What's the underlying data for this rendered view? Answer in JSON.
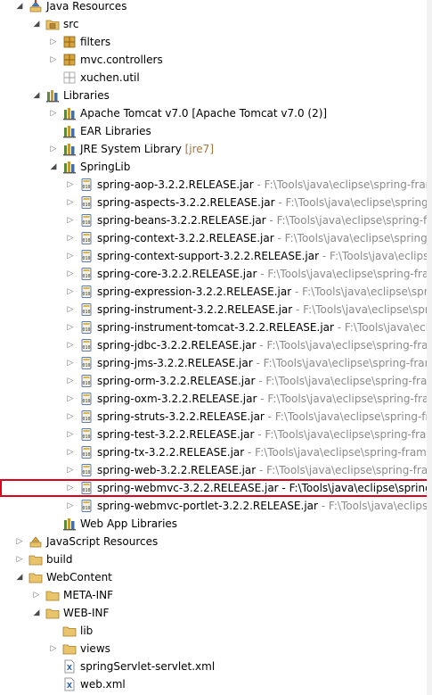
{
  "colors": {
    "highlight": "#e0001a",
    "decoration": "#8b8b8b",
    "version": "#a6763a",
    "folder": "#e9c46a",
    "jar": "#5a7fb0"
  },
  "tree": [
    {
      "label": "Java Resources",
      "decoration": "",
      "level": 0,
      "toggle": "open",
      "icon": "java-resources",
      "name": "tree-item-java-resources"
    },
    {
      "label": "src",
      "decoration": "",
      "level": 1,
      "toggle": "open",
      "icon": "source-folder",
      "name": "tree-item-src"
    },
    {
      "label": "filters",
      "decoration": "",
      "level": 2,
      "toggle": "closed",
      "icon": "package",
      "name": "tree-item-filters"
    },
    {
      "label": "mvc.controllers",
      "decoration": "",
      "level": 2,
      "toggle": "closed",
      "icon": "package",
      "name": "tree-item-mvc-controllers"
    },
    {
      "label": "xuchen.util",
      "decoration": "",
      "level": 2,
      "toggle": "none",
      "icon": "empty-package",
      "name": "tree-item-xuchen-util"
    },
    {
      "label": "Libraries",
      "decoration": "",
      "level": 1,
      "toggle": "open",
      "icon": "library",
      "name": "tree-item-libraries"
    },
    {
      "label": "Apache Tomcat v7.0 [Apache Tomcat v7.0 (2)]",
      "decoration": "",
      "level": 2,
      "toggle": "closed",
      "icon": "library",
      "name": "tree-item-apache-tomcat"
    },
    {
      "label": "EAR Libraries",
      "decoration": "",
      "level": 2,
      "toggle": "none",
      "icon": "library",
      "name": "tree-item-ear-libraries"
    },
    {
      "label": "JRE System Library",
      "decoration": " [jre7]",
      "decoration_style": "ver",
      "level": 2,
      "toggle": "closed",
      "icon": "library",
      "name": "tree-item-jre-system-library"
    },
    {
      "label": "SpringLib",
      "decoration": "",
      "level": 2,
      "toggle": "open",
      "icon": "library",
      "name": "tree-item-springlib"
    },
    {
      "label": "spring-aop-3.2.2.RELEASE.jar",
      "decoration": " - F:\\Tools\\java\\eclipse\\spring-fram",
      "level": 3,
      "toggle": "closed",
      "icon": "jar",
      "name": "tree-item-jar"
    },
    {
      "label": "spring-aspects-3.2.2.RELEASE.jar",
      "decoration": " - F:\\Tools\\java\\eclipse\\spring-f",
      "level": 3,
      "toggle": "closed",
      "icon": "jar",
      "name": "tree-item-jar"
    },
    {
      "label": "spring-beans-3.2.2.RELEASE.jar",
      "decoration": " - F:\\Tools\\java\\eclipse\\spring-fra",
      "level": 3,
      "toggle": "closed",
      "icon": "jar",
      "name": "tree-item-jar"
    },
    {
      "label": "spring-context-3.2.2.RELEASE.jar",
      "decoration": " - F:\\Tools\\java\\eclipse\\spring-f",
      "level": 3,
      "toggle": "closed",
      "icon": "jar",
      "name": "tree-item-jar"
    },
    {
      "label": "spring-context-support-3.2.2.RELEASE.jar",
      "decoration": " - F:\\Tools\\java\\eclipse\\",
      "level": 3,
      "toggle": "closed",
      "icon": "jar",
      "name": "tree-item-jar"
    },
    {
      "label": "spring-core-3.2.2.RELEASE.jar",
      "decoration": " - F:\\Tools\\java\\eclipse\\spring-fram",
      "level": 3,
      "toggle": "closed",
      "icon": "jar",
      "name": "tree-item-jar"
    },
    {
      "label": "spring-expression-3.2.2.RELEASE.jar",
      "decoration": " - F:\\Tools\\java\\eclipse\\sprin",
      "level": 3,
      "toggle": "closed",
      "icon": "jar",
      "name": "tree-item-jar"
    },
    {
      "label": "spring-instrument-3.2.2.RELEASE.jar",
      "decoration": " - F:\\Tools\\java\\eclipse\\sprin",
      "level": 3,
      "toggle": "closed",
      "icon": "jar",
      "name": "tree-item-jar"
    },
    {
      "label": "spring-instrument-tomcat-3.2.2.RELEASE.jar",
      "decoration": " - F:\\Tools\\java\\eclip",
      "level": 3,
      "toggle": "closed",
      "icon": "jar",
      "name": "tree-item-jar"
    },
    {
      "label": "spring-jdbc-3.2.2.RELEASE.jar",
      "decoration": " - F:\\Tools\\java\\eclipse\\spring-fram",
      "level": 3,
      "toggle": "closed",
      "icon": "jar",
      "name": "tree-item-jar"
    },
    {
      "label": "spring-jms-3.2.2.RELEASE.jar",
      "decoration": " - F:\\Tools\\java\\eclipse\\spring-fram",
      "level": 3,
      "toggle": "closed",
      "icon": "jar",
      "name": "tree-item-jar"
    },
    {
      "label": "spring-orm-3.2.2.RELEASE.jar",
      "decoration": " - F:\\Tools\\java\\eclipse\\spring-fram",
      "level": 3,
      "toggle": "closed",
      "icon": "jar",
      "name": "tree-item-jar"
    },
    {
      "label": "spring-oxm-3.2.2.RELEASE.jar",
      "decoration": " - F:\\Tools\\java\\eclipse\\spring-fram",
      "level": 3,
      "toggle": "closed",
      "icon": "jar",
      "name": "tree-item-jar"
    },
    {
      "label": "spring-struts-3.2.2.RELEASE.jar",
      "decoration": " - F:\\Tools\\java\\eclipse\\spring-fra",
      "level": 3,
      "toggle": "closed",
      "icon": "jar",
      "name": "tree-item-jar"
    },
    {
      "label": "spring-test-3.2.2.RELEASE.jar",
      "decoration": " - F:\\Tools\\java\\eclipse\\spring-fram",
      "level": 3,
      "toggle": "closed",
      "icon": "jar",
      "name": "tree-item-jar"
    },
    {
      "label": "spring-tx-3.2.2.RELEASE.jar",
      "decoration": " - F:\\Tools\\java\\eclipse\\spring-framev",
      "level": 3,
      "toggle": "closed",
      "icon": "jar",
      "name": "tree-item-jar"
    },
    {
      "label": "spring-web-3.2.2.RELEASE.jar",
      "decoration": " - F:\\Tools\\java\\eclipse\\spring-fram",
      "level": 3,
      "toggle": "closed",
      "icon": "jar",
      "name": "tree-item-jar"
    },
    {
      "label": "spring-webmvc-3.2.2.RELEASE.jar",
      "decoration": " - F:\\Tools\\java\\eclipse\\spring",
      "decoration_style": "dark",
      "level": 3,
      "toggle": "closed",
      "icon": "jar",
      "highlight": true,
      "name": "tree-item-spring-webmvc-jar"
    },
    {
      "label": "spring-webmvc-portlet-3.2.2.RELEASE.jar",
      "decoration": " - F:\\Tools\\java\\eclipse\\",
      "level": 3,
      "toggle": "closed",
      "icon": "jar",
      "name": "tree-item-jar"
    },
    {
      "label": "Web App Libraries",
      "decoration": "",
      "level": 2,
      "toggle": "none",
      "icon": "library",
      "name": "tree-item-web-app-libraries"
    },
    {
      "label": "JavaScript Resources",
      "decoration": "",
      "level": 0,
      "toggle": "closed",
      "icon": "js-resources",
      "name": "tree-item-javascript-resources"
    },
    {
      "label": "build",
      "decoration": "",
      "level": 0,
      "toggle": "closed",
      "icon": "folder",
      "name": "tree-item-build"
    },
    {
      "label": "WebContent",
      "decoration": "",
      "level": 0,
      "toggle": "open",
      "icon": "folder",
      "name": "tree-item-webcontent"
    },
    {
      "label": "META-INF",
      "decoration": "",
      "level": 1,
      "toggle": "closed",
      "icon": "folder",
      "name": "tree-item-meta-inf"
    },
    {
      "label": "WEB-INF",
      "decoration": "",
      "level": 1,
      "toggle": "open",
      "icon": "folder",
      "name": "tree-item-web-inf"
    },
    {
      "label": "lib",
      "decoration": "",
      "level": 2,
      "toggle": "none",
      "icon": "folder",
      "name": "tree-item-lib"
    },
    {
      "label": "views",
      "decoration": "",
      "level": 2,
      "toggle": "closed",
      "icon": "folder",
      "name": "tree-item-views"
    },
    {
      "label": "springServlet-servlet.xml",
      "decoration": "",
      "level": 2,
      "toggle": "none",
      "icon": "xml-file",
      "name": "tree-item-springservlet-xml"
    },
    {
      "label": "web.xml",
      "decoration": "",
      "level": 2,
      "toggle": "none",
      "icon": "xml-file",
      "name": "tree-item-web-xml"
    }
  ]
}
